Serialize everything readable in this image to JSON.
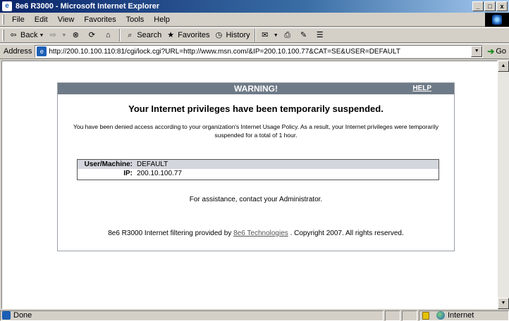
{
  "window": {
    "title": "8e6 R3000 - Microsoft Internet Explorer",
    "buttons": {
      "minimize": "_",
      "restore": "□",
      "close": "x"
    }
  },
  "menu": [
    "File",
    "Edit",
    "View",
    "Favorites",
    "Tools",
    "Help"
  ],
  "toolbar": {
    "back": "Back",
    "search": "Search",
    "favorites": "Favorites",
    "history": "History"
  },
  "address": {
    "label": "Address",
    "url": "http://200.10.100.110:81/cgi/lock.cgi?URL=http://www.msn.com/&IP=200.10.100.77&CAT=SE&USER=DEFAULT",
    "go": "Go"
  },
  "page": {
    "header": "WARNING!",
    "help": "HELP",
    "headline": "Your Internet privileges have been temporarily suspended.",
    "notice": "You have been denied access according to your organization's Internet Usage Policy. As a result, your Internet privileges were temporarily suspended for a total of 1 hour.",
    "info": [
      {
        "label": "User/Machine:",
        "value": "DEFAULT"
      },
      {
        "label": "IP:",
        "value": "200.10.100.77"
      }
    ],
    "assistance": "For assistance, contact your Administrator.",
    "footer_prefix": "8e6 R3000 Internet filtering provided by",
    "footer_link": "8e6 Technologies",
    "footer_suffix": ". Copyright 2007. All rights reserved."
  },
  "status": {
    "text": "Done",
    "zone": "Internet"
  },
  "colors": {
    "title_bar": "#0a246a",
    "panel_header": "#6e7a87",
    "info_shade": "#d3d6dc"
  }
}
